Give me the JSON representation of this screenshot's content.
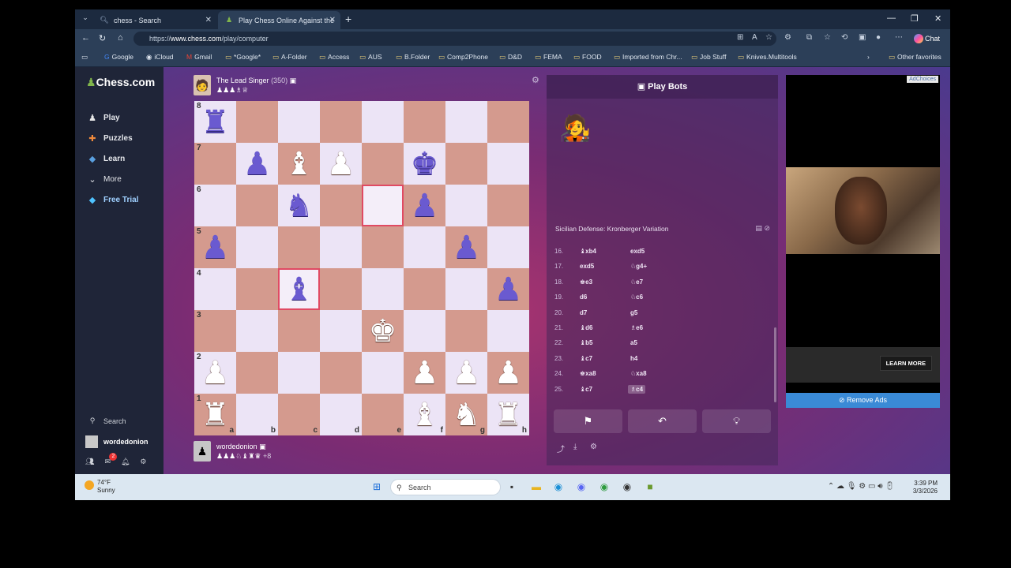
{
  "browser": {
    "tabs": [
      {
        "title": "chess - Search"
      },
      {
        "title": "Play Chess Online Against the"
      }
    ],
    "url_prefix": "https://",
    "url_host": "www.chess.com",
    "url_path": "/play/computer",
    "chat_label": "Chat",
    "bookmarks": [
      "Google",
      "iCloud",
      "Gmail",
      "*Google*",
      "A-Folder",
      "Access",
      "AUS",
      "B.Folder",
      "Comp2Phone",
      "D&D",
      "FEMA",
      "FOOD",
      "Imported from Chr...",
      "Job Stuff",
      "Knives.Multitools"
    ],
    "other_favorites": "Other favorites"
  },
  "sidebar": {
    "logo": "Chess.com",
    "items": [
      {
        "label": "Play",
        "icon": "play-icon"
      },
      {
        "label": "Puzzles",
        "icon": "puzzle-icon"
      },
      {
        "label": "Learn",
        "icon": "learn-icon"
      },
      {
        "label": "More",
        "icon": "chevron-down-icon"
      },
      {
        "label": "Free Trial",
        "icon": "diamond-icon"
      }
    ],
    "search_label": "Search",
    "username": "wordedonion",
    "notifications_count": "2"
  },
  "game": {
    "top_player": {
      "name": "The Lead Singer",
      "rating": "(350)",
      "captured": "♟♟♟♗♕"
    },
    "bottom_player": {
      "name": "wordedonion",
      "captured": "♟♟♟♘♝♜♛",
      "advantage": "+8"
    },
    "ranks": [
      "8",
      "7",
      "6",
      "5",
      "4",
      "3",
      "2",
      "1"
    ],
    "files": [
      "a",
      "b",
      "c",
      "d",
      "e",
      "f",
      "g",
      "h"
    ]
  },
  "panel": {
    "title": "Play Bots",
    "opening": "Sicilian Defense: Kronberger Variation",
    "moves": [
      {
        "n": "16.",
        "w": "♝xb4",
        "b": "exd5"
      },
      {
        "n": "17.",
        "w": "exd5",
        "b": "♘g4+"
      },
      {
        "n": "18.",
        "w": "♚e3",
        "b": "♘e7"
      },
      {
        "n": "19.",
        "w": "d6",
        "b": "♘c6"
      },
      {
        "n": "20.",
        "w": "d7",
        "b": "g5"
      },
      {
        "n": "21.",
        "w": "♝d6",
        "b": "♗e6"
      },
      {
        "n": "22.",
        "w": "♝b5",
        "b": "a5"
      },
      {
        "n": "23.",
        "w": "♝c7",
        "b": "h4"
      },
      {
        "n": "24.",
        "w": "♚xa8",
        "b": "♘xa8"
      },
      {
        "n": "25.",
        "w": "♝c7",
        "b": "♗c4"
      }
    ]
  },
  "ad": {
    "adchoices": "AdChoices",
    "learn_more": "LEARN MORE",
    "remove_ads": "Remove Ads"
  },
  "taskbar": {
    "temp": "74°F",
    "weather": "Sunny",
    "search_label": "Search",
    "time": "3:39 PM",
    "date": "3/3/2026"
  }
}
